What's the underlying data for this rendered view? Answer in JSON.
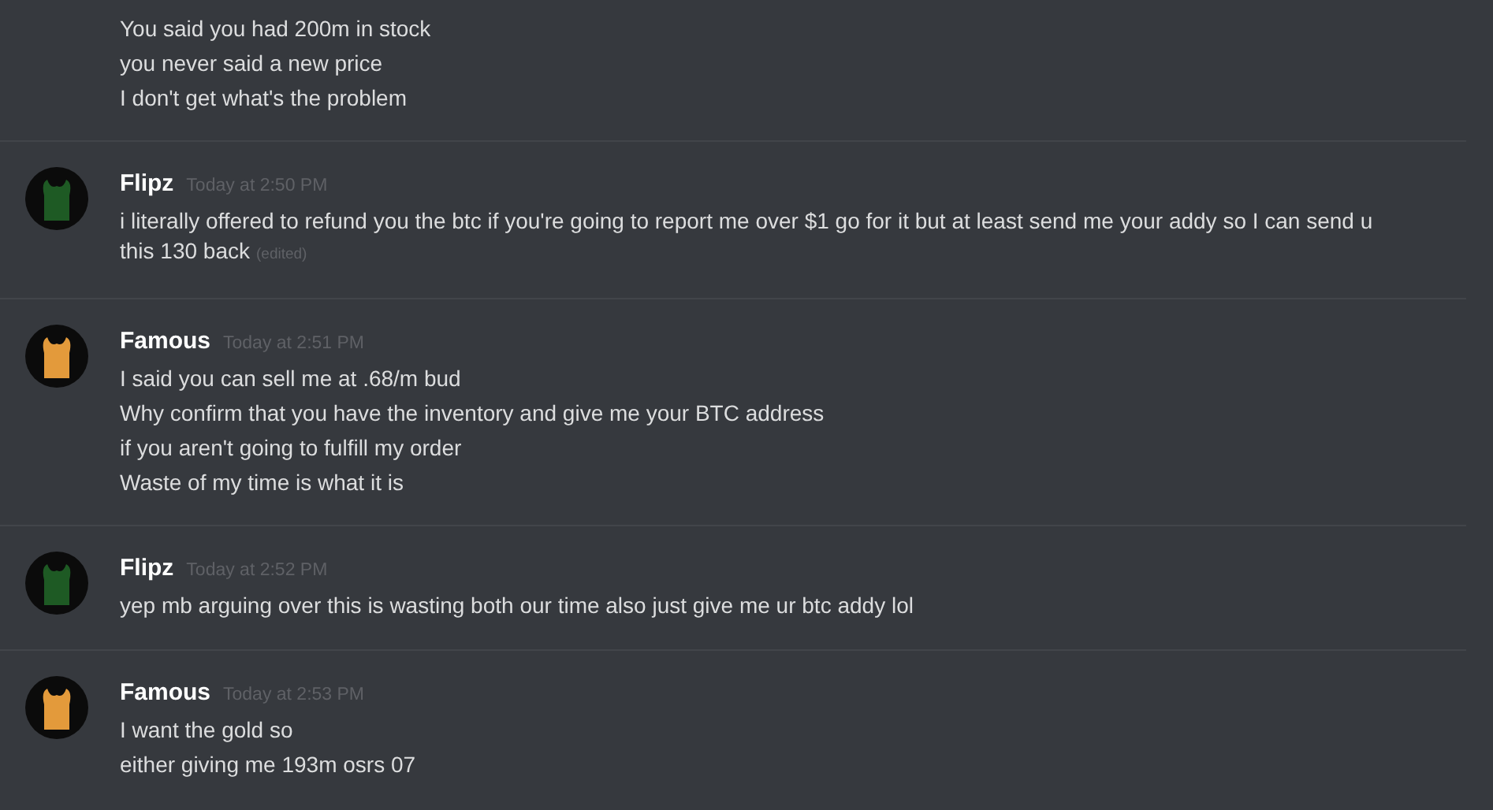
{
  "groups": [
    {
      "messages": [
        {
          "text": "You said you had 200m in stock"
        },
        {
          "text": "you never said a new price"
        },
        {
          "text": "I don't get what's the problem"
        }
      ]
    },
    {
      "author": "Flipz",
      "timestamp": "Today at 2:50 PM",
      "color": "#1e5a24",
      "messages": [
        {
          "text": "i literally offered to refund you the btc if you're going to report me over $1 go for it but at least send me your addy so I can send u this 130 back",
          "note": "(edited)"
        }
      ]
    },
    {
      "author": "Famous",
      "timestamp": "Today at 2:51 PM",
      "color": "#e39a3b",
      "messages": [
        {
          "text": "I said you can sell me at .68/m bud"
        },
        {
          "text": "Why confirm that you have the inventory and give me your BTC address"
        },
        {
          "text": "if you aren't going to fulfill my order"
        },
        {
          "text": "Waste of my time is what it is"
        }
      ]
    },
    {
      "author": "Flipz",
      "timestamp": "Today at 2:52 PM",
      "color": "#1e5a24",
      "messages": [
        {
          "text": "yep mb arguing over this is wasting both our time also just give me ur btc addy lol"
        }
      ]
    },
    {
      "author": "Famous",
      "timestamp": "Today at 2:53 PM",
      "color": "#e39a3b",
      "messages": [
        {
          "text": "I want the gold so"
        },
        {
          "text": "either giving me 193m osrs 07"
        }
      ]
    }
  ]
}
